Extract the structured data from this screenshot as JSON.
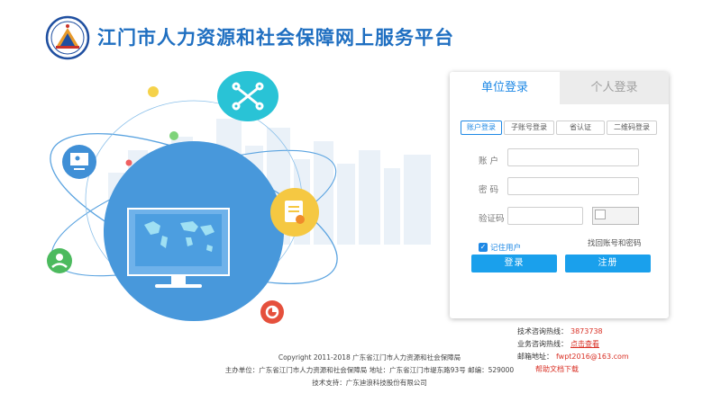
{
  "header": {
    "title": "江门市人力资源和社会保障网上服务平台",
    "logo_icon": "emblem-logo-icon"
  },
  "login": {
    "tabs": [
      "单位登录",
      "个人登录"
    ],
    "active_tab": "单位登录",
    "sub_tabs": [
      "账户登录",
      "子账号登录",
      "省认证",
      "二维码登录"
    ],
    "active_sub_tab": "账户登录",
    "account_label": "账  户",
    "password_label": "密  码",
    "captcha_label": "验证码",
    "account_value": "",
    "password_value": "",
    "captcha_value": "",
    "remember_label": "记住用户",
    "remember_checked": true,
    "forgot_label": "找回账号和密码",
    "login_button": "登录",
    "register_button": "注册"
  },
  "hotline": {
    "tech_label": "技术咨询热线：",
    "tech_value": "3873738",
    "biz_label": "业务咨询热线：",
    "biz_link": "点击查看",
    "email_label": "邮箱地址：",
    "email_value": "fwpt2016@163.com",
    "help_link": "帮助文档下载"
  },
  "footer": {
    "copyright": "Copyright 2011-2018 广东省江门市人力资源和社会保障局",
    "sponsor": "主办单位：广东省江门市人力资源和社会保障局  地址：广东省江门市堤东路93号  邮编：529000",
    "support": "技术支持：广东迪浪科技股份有限公司"
  },
  "colors": {
    "brand_blue": "#1f6fc1",
    "accent_blue": "#1e88e5",
    "button_blue": "#1aa0ec",
    "hotline_red": "#d93025",
    "globe_blue": "#3f8fd6",
    "teal_bubble": "#29c3d6",
    "yellow_bubble": "#f5c842",
    "green_bubble": "#4cba5e",
    "red_bubble": "#e5503c"
  },
  "illustration": {
    "icons": [
      "network-hub-icon",
      "certificate-icon",
      "presentation-icon",
      "user-support-icon",
      "pie-chart-icon",
      "world-map-monitor-icon",
      "city-skyline-icon"
    ]
  }
}
